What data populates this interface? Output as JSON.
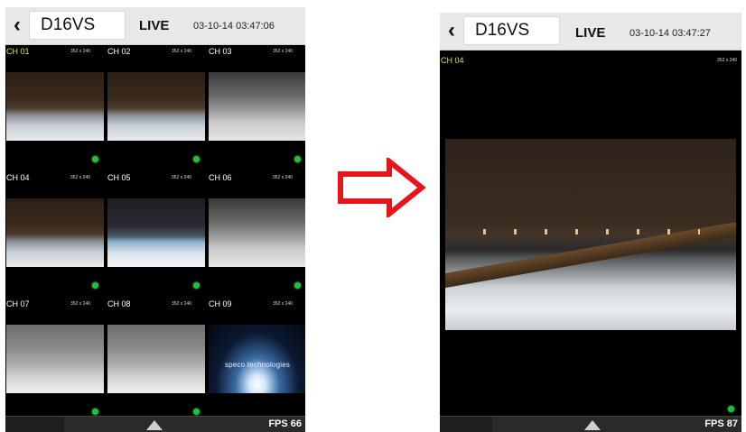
{
  "left": {
    "device": "D16VS",
    "mode": "LIVE",
    "datetime": "03-10-14 03:47:06",
    "resolution": "352 x 240",
    "channels": [
      {
        "label": "CH 01",
        "style": "night",
        "selected": true
      },
      {
        "label": "CH 02",
        "style": "night",
        "selected": false
      },
      {
        "label": "CH 03",
        "style": "grey",
        "selected": false
      },
      {
        "label": "CH 04",
        "style": "night",
        "selected": false
      },
      {
        "label": "CH 05",
        "style": "pool",
        "selected": false
      },
      {
        "label": "CH 06",
        "style": "grey",
        "selected": false
      },
      {
        "label": "CH 07",
        "style": "fog",
        "selected": false
      },
      {
        "label": "CH 08",
        "style": "fog",
        "selected": false
      },
      {
        "label": "CH 09",
        "style": "logo",
        "selected": false
      }
    ],
    "logo_text": "speco technologies",
    "fps": "FPS 66"
  },
  "right": {
    "device": "D16VS",
    "mode": "LIVE",
    "datetime": "03-10-14 03:47:27",
    "channel": "CH 04",
    "resolution": "352 x 240",
    "fps": "FPS 87"
  },
  "colors": {
    "arrow": "#e8141b",
    "selected_label": "#e2e24a",
    "status_dot": "#1fbf3a"
  }
}
